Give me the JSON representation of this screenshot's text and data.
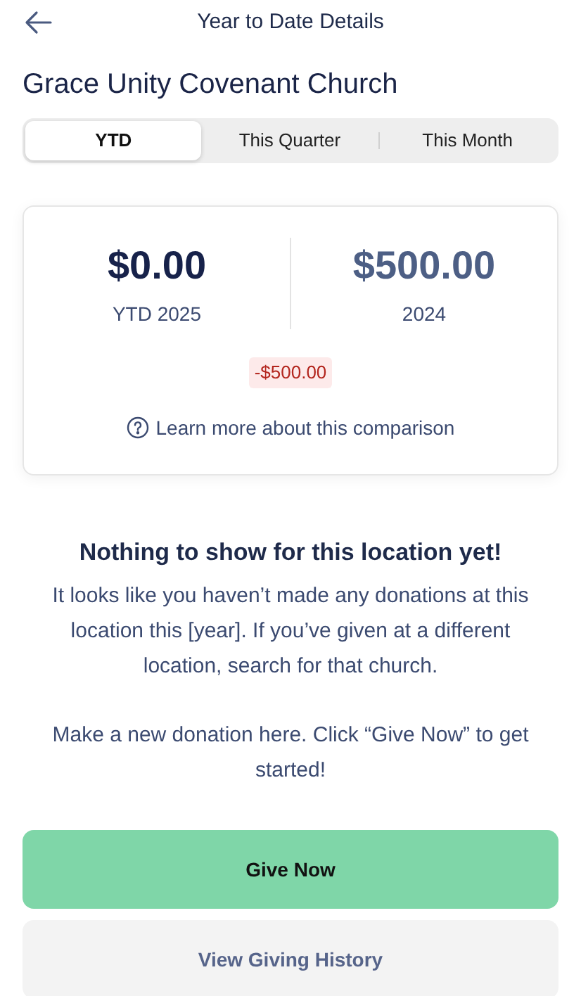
{
  "header": {
    "title": "Year to Date Details"
  },
  "church": "Grace Unity Covenant Church",
  "tabs": [
    {
      "label": "YTD",
      "selected": true
    },
    {
      "label": "This Quarter",
      "selected": false
    },
    {
      "label": "This Month",
      "selected": false
    }
  ],
  "comparison": {
    "current": {
      "amount": "$0.00",
      "label": "YTD 2025"
    },
    "previous": {
      "amount": "$500.00",
      "label": "2024"
    },
    "difference": "-$500.00",
    "link": "Learn more about this comparison"
  },
  "empty_state": {
    "title": "Nothing to show for this location yet!",
    "paragraphs": [
      "It looks like you haven’t made any donations at this location this [year]. If you’ve given at a different location, search for that church.",
      "Make a new donation here. Click “Give Now” to get started!"
    ]
  },
  "buttons": [
    {
      "label": "Give Now",
      "kind": "primary"
    },
    {
      "label": "View Giving History",
      "kind": "secondary"
    }
  ]
}
